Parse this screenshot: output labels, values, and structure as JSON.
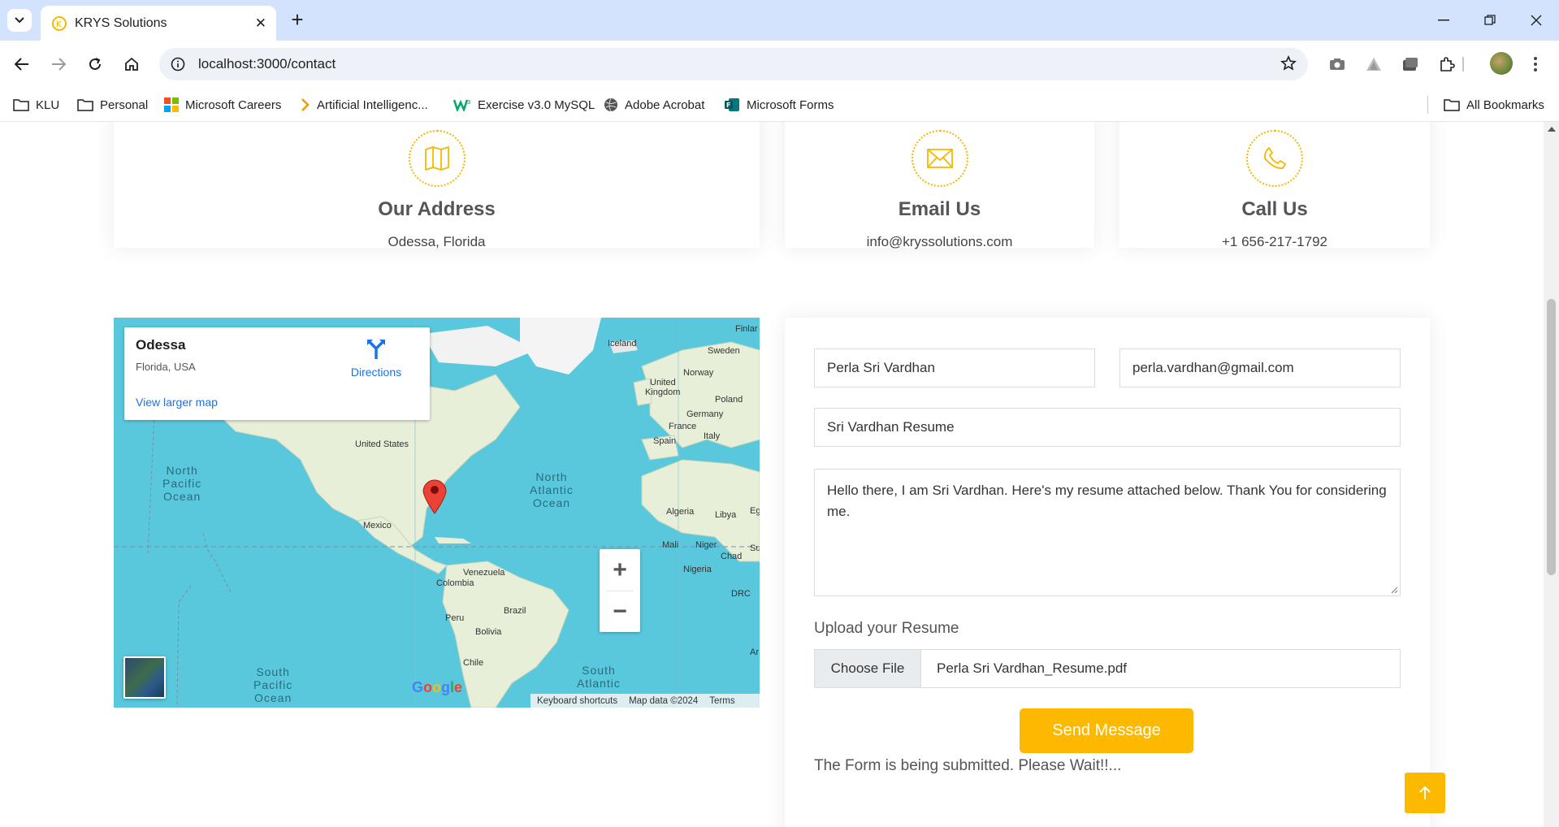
{
  "browser": {
    "tab_title": "KRYS Solutions",
    "tab_close": "✕",
    "new_tab": "+",
    "url": "localhost:3000/contact",
    "bookmarks": [
      {
        "label": "KLU",
        "icon": "folder-icon"
      },
      {
        "label": "Personal",
        "icon": "folder-icon"
      },
      {
        "label": "Microsoft Careers",
        "icon": "microsoft-logo-icon"
      },
      {
        "label": "Artificial Intelligenc...",
        "icon": "chevron-bookmark-icon"
      },
      {
        "label": "Exercise v3.0 MySQL",
        "icon": "w3-icon"
      },
      {
        "label": "Adobe Acrobat",
        "icon": "globe-icon"
      },
      {
        "label": "Microsoft Forms",
        "icon": "forms-icon"
      }
    ],
    "all_bookmarks": "All Bookmarks"
  },
  "contact_info": {
    "address": {
      "title": "Our Address",
      "value": "Odessa, Florida",
      "icon": "map-icon"
    },
    "email": {
      "title": "Email Us",
      "value": "info@kryssolutions.com",
      "icon": "envelope-icon"
    },
    "phone": {
      "title": "Call Us",
      "value": "+1 656-217-1792",
      "icon": "phone-icon"
    }
  },
  "map": {
    "place": "Odessa",
    "region": "Florida, USA",
    "directions": "Directions",
    "view_larger": "View larger map",
    "labels": {
      "iceland": "Iceland",
      "sweden": "Sweden",
      "finland": "Finlar",
      "norway": "Norway",
      "united_kingdom_1": "United",
      "united_kingdom_2": "Kingdom",
      "poland": "Poland",
      "germany": "Germany",
      "france": "France",
      "italy": "Italy",
      "spain": "Spain",
      "united_states": "United States",
      "mexico": "Mexico",
      "algeria": "Algeria",
      "libya": "Libya",
      "egypt": "Eg",
      "mali": "Mali",
      "niger": "Niger",
      "chad": "Chad",
      "sudan": "Su",
      "nigeria": "Nigeria",
      "venezuela": "Venezuela",
      "colombia": "Colombia",
      "peru": "Peru",
      "brazil": "Brazil",
      "bolivia": "Bolivia",
      "chile": "Chile",
      "drc": "DRC",
      "angola": "Ar"
    },
    "oceans": {
      "north_pacific": [
        "North",
        "Pacific",
        "Ocean"
      ],
      "north_atlantic": [
        "North",
        "Atlantic",
        "Ocean"
      ],
      "south_pacific": [
        "South",
        "Pacific",
        "Ocean"
      ],
      "south_atlantic": [
        "South",
        "Atlantic"
      ]
    },
    "zoom_in": "+",
    "zoom_out": "−",
    "footer": {
      "shortcuts": "Keyboard shortcuts",
      "data": "Map data ©2024",
      "terms": "Terms"
    },
    "google": "Google"
  },
  "form": {
    "name_value": "Perla Sri Vardhan",
    "email_value": "perla.vardhan@gmail.com",
    "subject_value": "Sri Vardhan Resume",
    "message_value": "Hello there, I am Sri Vardhan. Here's my resume attached below. Thank You for considering me.",
    "upload_label": "Upload your Resume",
    "choose_file": "Choose File",
    "file_name": "Perla Sri Vardhan_Resume.pdf",
    "send_label": "Send Message",
    "status": "The Form is being submitted. Please Wait!!..."
  },
  "colors": {
    "accent": "#fcb900",
    "tabbar": "#d3e3fd",
    "link": "#1a73e8",
    "ocean": "#5ac8dc",
    "land": "#e8efd9"
  }
}
